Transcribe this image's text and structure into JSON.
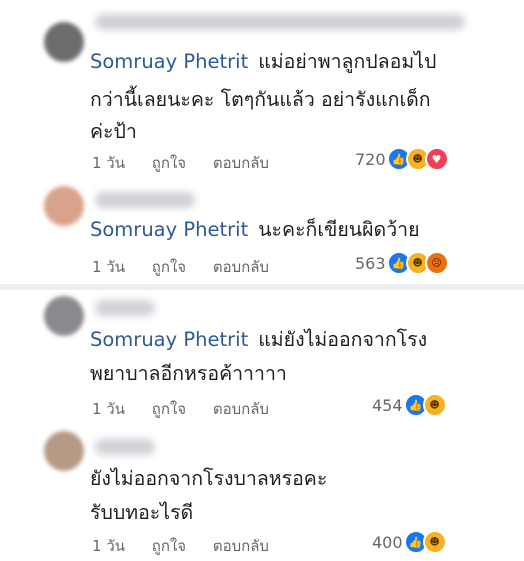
{
  "comments": [
    {
      "mention": "Somruay Phetrit",
      "lines": [
        "แม่อย่าพาลูกปลอมไป",
        "กว่านี้เลยนะคะ โตๆกันแล้ว อย่ารังแกเด็ก",
        "ค่ะป้า"
      ],
      "time": "1 วัน",
      "like_label": "ถูกใจ",
      "reply_label": "ตอบกลับ",
      "reaction_count": "720",
      "reactions": [
        "like-icon",
        "haha-icon",
        "love-icon"
      ]
    },
    {
      "mention": "Somruay Phetrit",
      "lines": [
        "นะคะก็เขียนผิดว้าย"
      ],
      "time": "1 วัน",
      "like_label": "ถูกใจ",
      "reply_label": "ตอบกลับ",
      "reaction_count": "563",
      "reactions": [
        "like-icon",
        "haha-icon",
        "angry-icon"
      ]
    },
    {
      "mention": "Somruay Phetrit",
      "lines": [
        "แม่ยังไม่ออกจากโรง",
        "พยาบาลอีกหรอค้าาาาา"
      ],
      "time": "1 วัน",
      "like_label": "ถูกใจ",
      "reply_label": "ตอบกลับ",
      "reaction_count": "454",
      "reactions": [
        "like-icon",
        "haha-icon"
      ]
    },
    {
      "mention": "",
      "lines": [
        "ยังไม่ออกจากโรงบาลหรอคะ",
        "รับบทอะไรดี"
      ],
      "time": "1 วัน",
      "like_label": "ถูกใจ",
      "reply_label": "ตอบกลับ",
      "reaction_count": "400",
      "reactions": [
        "like-icon",
        "haha-icon"
      ]
    }
  ]
}
